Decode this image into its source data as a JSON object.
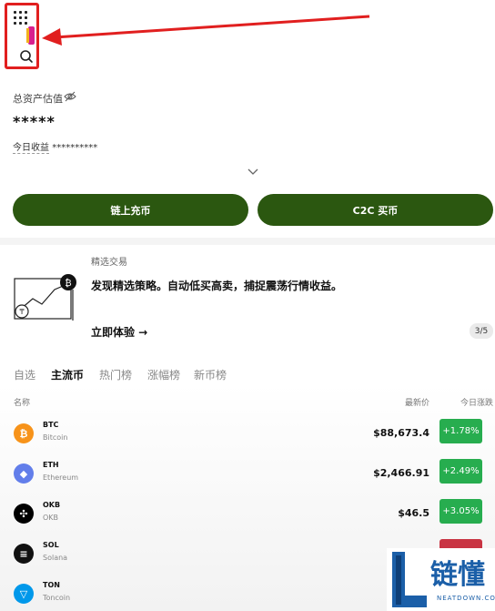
{
  "assets": {
    "label": "总资产估值",
    "value": "*****",
    "today_label": "今日收益",
    "today_value": "**********"
  },
  "buttons": {
    "onchain": "链上充币",
    "c2c": "C2C 买币"
  },
  "promo": {
    "tag": "精选交易",
    "title": "发现精选策略。自动低买高卖，捕捉震荡行情收益。",
    "cta": "立即体验 →",
    "pager": "3/5"
  },
  "tabs": [
    "自选",
    "主流币",
    "热门榜",
    "涨幅榜",
    "新币榜"
  ],
  "table": {
    "col_name": "名称",
    "col_price": "最新价",
    "col_change": "今日涨跌"
  },
  "coins": [
    {
      "symbol": "BTC",
      "name": "Bitcoin",
      "price": "$88,673.4",
      "change": "+1.78%",
      "color": "#f7931a",
      "glyph": "₿"
    },
    {
      "symbol": "ETH",
      "name": "Ethereum",
      "price": "$2,466.91",
      "change": "+2.49%",
      "color": "#627eea",
      "glyph": "◆"
    },
    {
      "symbol": "OKB",
      "name": "OKB",
      "price": "$46.5",
      "change": "+3.05%",
      "color": "#000000",
      "glyph": "✣"
    },
    {
      "symbol": "SOL",
      "name": "Solana",
      "price": "",
      "change": "",
      "color": "#111111",
      "glyph": "≡"
    },
    {
      "symbol": "TON",
      "name": "Toncoin",
      "price": "",
      "change": "",
      "color": "#0098ea",
      "glyph": "▽"
    }
  ],
  "watermark": {
    "brand": "链懂",
    "url": "NEATDOWN.COM"
  },
  "colors": {
    "primary_green": "#2b5710",
    "up_green": "#27ad4f",
    "down_red": "#c93443",
    "highlight_red": "#e11f1f"
  }
}
